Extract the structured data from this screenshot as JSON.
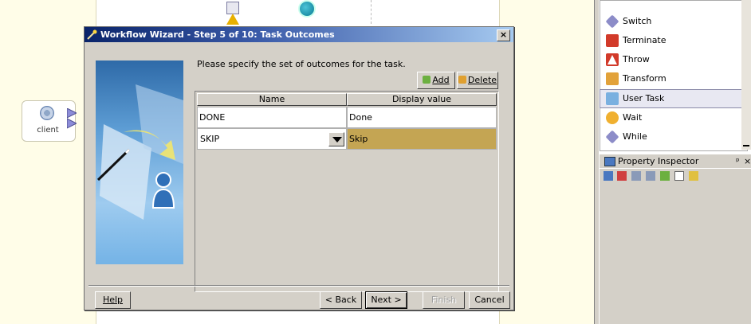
{
  "dialog": {
    "title": "Workflow Wizard - Step 5 of 10: Task Outcomes",
    "close_glyph": "×",
    "instruction": "Please specify the set of outcomes for the task.",
    "add_label": "Add",
    "delete_label": "Delete",
    "columns": [
      "Name",
      "Display value"
    ],
    "rows": [
      {
        "name": "DONE",
        "display": "Done"
      },
      {
        "name": "SKIP",
        "display": "Skip",
        "selected": true
      }
    ],
    "buttons": {
      "help": "Help",
      "back": "< Back",
      "next": "Next >",
      "finish": "Finish",
      "cancel": "Cancel"
    }
  },
  "canvas": {
    "client_label": "client"
  },
  "palette": {
    "items": [
      {
        "label": "Switch",
        "icon": "switch-icon",
        "color": "#8c8cc8"
      },
      {
        "label": "Terminate",
        "icon": "terminate-icon",
        "color": "#d23a2a"
      },
      {
        "label": "Throw",
        "icon": "throw-icon",
        "color": "#d23a2a"
      },
      {
        "label": "Transform",
        "icon": "transform-icon",
        "color": "#e2a23a"
      },
      {
        "label": "User Task",
        "icon": "user-task-icon",
        "color": "#7ab0e0",
        "selected": true
      },
      {
        "label": "Wait",
        "icon": "wait-icon",
        "color": "#f0b030"
      },
      {
        "label": "While",
        "icon": "while-icon",
        "color": "#8c8cc8"
      }
    ]
  },
  "property_inspector": {
    "title": "Property Inspector",
    "pin_glyph": "ᵖ",
    "close_glyph": "×"
  },
  "colors": {
    "selected_row": "#c4a553",
    "title_bar_start": "#0a246a",
    "title_bar_end": "#a6caf0"
  }
}
